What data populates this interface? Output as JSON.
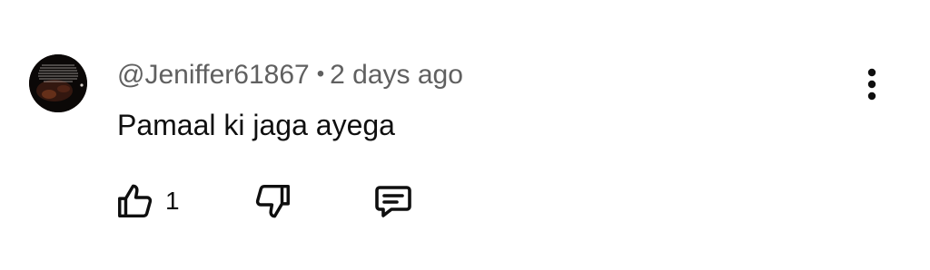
{
  "comment": {
    "author": "@Jeniffer61867",
    "separator": "•",
    "timestamp": "2 days ago",
    "text": "Pamaal ki jaga ayega",
    "like_count": "1",
    "icons": {
      "avatar": "avatar-image",
      "more": "more-vert-icon",
      "like": "thumbs-up-icon",
      "dislike": "thumbs-down-icon",
      "reply": "reply-comment-icon"
    },
    "colors": {
      "meta_text": "#606060",
      "body_text": "#0f0f0f",
      "icon": "#0f0f0f"
    }
  }
}
